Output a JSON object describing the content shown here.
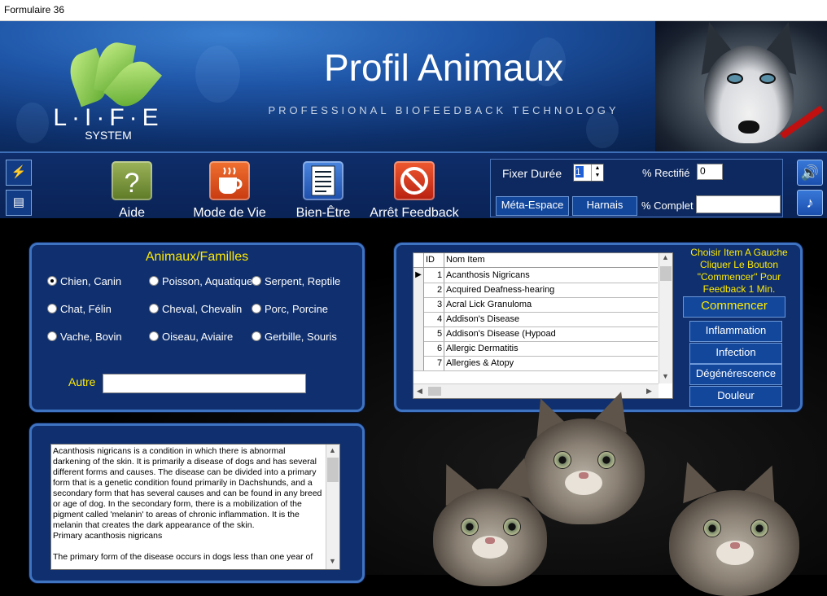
{
  "window": {
    "title": "Formulaire 36"
  },
  "header": {
    "app_title": "Profil Animaux",
    "subtitle": "PROFESSIONAL BIOFEEDBACK TECHNOLOGY",
    "logo_text": "L·I·F·E",
    "logo_sub": "SYSTEM"
  },
  "toolbar": {
    "aide": "Aide",
    "mode_de_vie": "Mode de Vie",
    "bien_etre": "Bien-Être",
    "arret_feedback": "Arrêt Feedback"
  },
  "controls": {
    "fixer_duree_label": "Fixer Durée",
    "fixer_duree_value": "1",
    "pct_rectifie_label": "% Rectifié",
    "pct_rectifie_value": "0",
    "meta_espace": "Méta-Espace",
    "harnais": "Harnais",
    "pct_complet_label": "% Complet",
    "pct_complet_value": ""
  },
  "animals": {
    "title": "Animaux/Familles",
    "options": [
      {
        "label": "Chien, Canin",
        "checked": true
      },
      {
        "label": "Poisson, Aquatique",
        "checked": false
      },
      {
        "label": "Serpent, Reptile",
        "checked": false
      },
      {
        "label": "Chat, Félin",
        "checked": false
      },
      {
        "label": "Cheval, Chevalin",
        "checked": false
      },
      {
        "label": "Porc, Porcine",
        "checked": false
      },
      {
        "label": "Vache, Bovin",
        "checked": false
      },
      {
        "label": "Oiseau, Aviaire",
        "checked": false
      },
      {
        "label": "Gerbille, Souris",
        "checked": false
      }
    ],
    "autre_label": "Autre",
    "autre_value": ""
  },
  "items_grid": {
    "columns": [
      "ID",
      "Nom Item"
    ],
    "rows": [
      {
        "id": "1",
        "name": "Acanthosis Nigricans"
      },
      {
        "id": "2",
        "name": "Acquired Deafness-hearing"
      },
      {
        "id": "3",
        "name": "Acral Lick Granuloma"
      },
      {
        "id": "4",
        "name": "Addison's Disease"
      },
      {
        "id": "5",
        "name": "Addison's Disease (Hypoad"
      },
      {
        "id": "6",
        "name": "Allergic Dermatitis"
      },
      {
        "id": "7",
        "name": "Allergies & Atopy"
      }
    ]
  },
  "instructions": "Choisir Item A Gauche Cliquer Le Bouton \"Commencer\" Pour Feedback 1 Min.",
  "actions": {
    "commencer": "Commencer",
    "inflammation": "Inflammation",
    "infection": "Infection",
    "degenerescence": "Dégénérescence",
    "douleur": "Douleur"
  },
  "description": "Acanthosis nigricans is a condition in which there is abnormal darkening of the skin. It is primarily a disease of dogs and has several different forms and causes. The disease can be divided into a primary form that is a genetic condition found primarily in Dachshunds, and a secondary form that has several causes and can be found in any breed or age of dog. In the secondary form, there is a mobilization of the pigment called 'melanin' to areas of chronic inflammation. It is the melanin that creates the dark appearance of the skin.\nPrimary acanthosis nigricans\n\nThe primary form of the disease occurs in dogs less than one year of",
  "icons": {
    "side_top": "wand-icon",
    "side_bottom": "chat-icon",
    "speaker": "speaker-icon",
    "music": "music-note-icon"
  },
  "colors": {
    "accent_yellow": "#ffea00",
    "panel_blue": "#0f2f6e",
    "border_blue": "#3f74c2",
    "aide_green": "#7a9a3a",
    "mode_orange": "#e0521c",
    "bien_blue": "#2a62c8",
    "arret_red": "#d22e1a"
  }
}
